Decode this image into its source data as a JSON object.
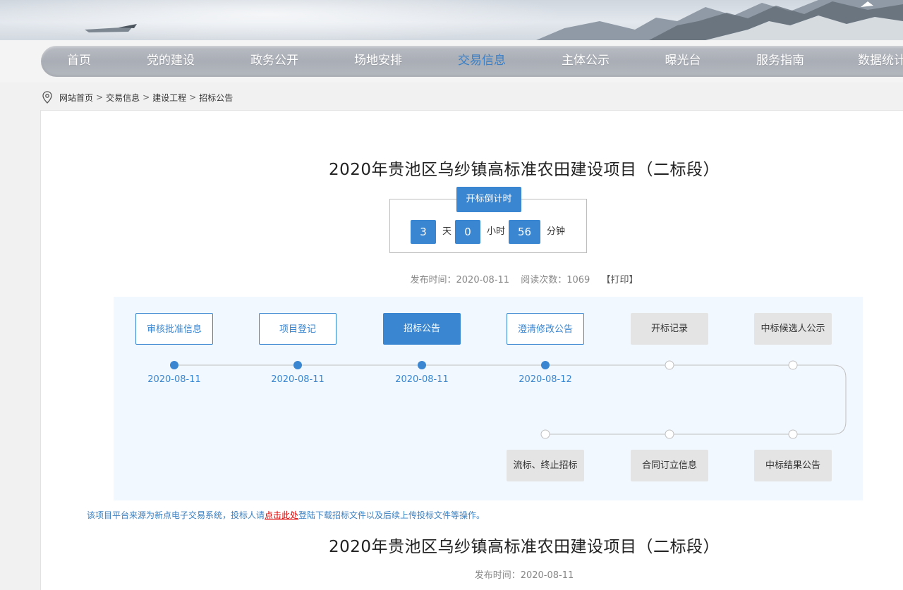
{
  "nav": {
    "items": [
      {
        "label": "首页",
        "active": false
      },
      {
        "label": "党的建设",
        "active": false
      },
      {
        "label": "政务公开",
        "active": false
      },
      {
        "label": "场地安排",
        "active": false
      },
      {
        "label": "交易信息",
        "active": true
      },
      {
        "label": "主体公示",
        "active": false
      },
      {
        "label": "曝光台",
        "active": false
      },
      {
        "label": "服务指南",
        "active": false
      },
      {
        "label": "数据统计",
        "active": false
      }
    ]
  },
  "breadcrumb": [
    "网站首页",
    "交易信息",
    "建设工程",
    "招标公告"
  ],
  "breadcrumb_separator": ">",
  "project": {
    "title": "2020年贵池区乌纱镇高标准农田建设项目（二标段）"
  },
  "countdown": {
    "label": "开标倒计时",
    "days": "3",
    "days_unit": "天",
    "hours": "0",
    "hours_unit": "小时",
    "minutes": "56",
    "minutes_unit": "分钟"
  },
  "meta": {
    "publish": "发布时间：2020-08-11",
    "reads": "阅读次数：1069",
    "print": "【打印】"
  },
  "timeline": {
    "steps": [
      {
        "label": "审核批准信息",
        "state": "done",
        "date": "2020-08-11"
      },
      {
        "label": "项目登记",
        "state": "done",
        "date": "2020-08-11"
      },
      {
        "label": "招标公告",
        "state": "current",
        "date": "2020-08-11"
      },
      {
        "label": "澄清修改公告",
        "state": "done",
        "date": "2020-08-12"
      },
      {
        "label": "开标记录",
        "state": "todo",
        "date": ""
      },
      {
        "label": "中标候选人公示",
        "state": "todo",
        "date": ""
      },
      {
        "label": "流标、终止招标",
        "state": "todo",
        "date": ""
      },
      {
        "label": "合同订立信息",
        "state": "todo",
        "date": ""
      },
      {
        "label": "中标结果公告",
        "state": "todo",
        "date": ""
      }
    ],
    "colors": {
      "accent": "#3a86d1",
      "todo": "#e4e4e4",
      "line": "#bfbfbf"
    }
  },
  "note": {
    "before": "该项目平台来源为新点电子交易系统，投标人请",
    "link": "点击此处",
    "after": "登陆下载招标文件以及后续上传投标文件等操作。"
  },
  "second": {
    "title": "2020年贵池区乌纱镇高标准农田建设项目（二标段）",
    "publish": "发布时间：2020-08-11"
  }
}
